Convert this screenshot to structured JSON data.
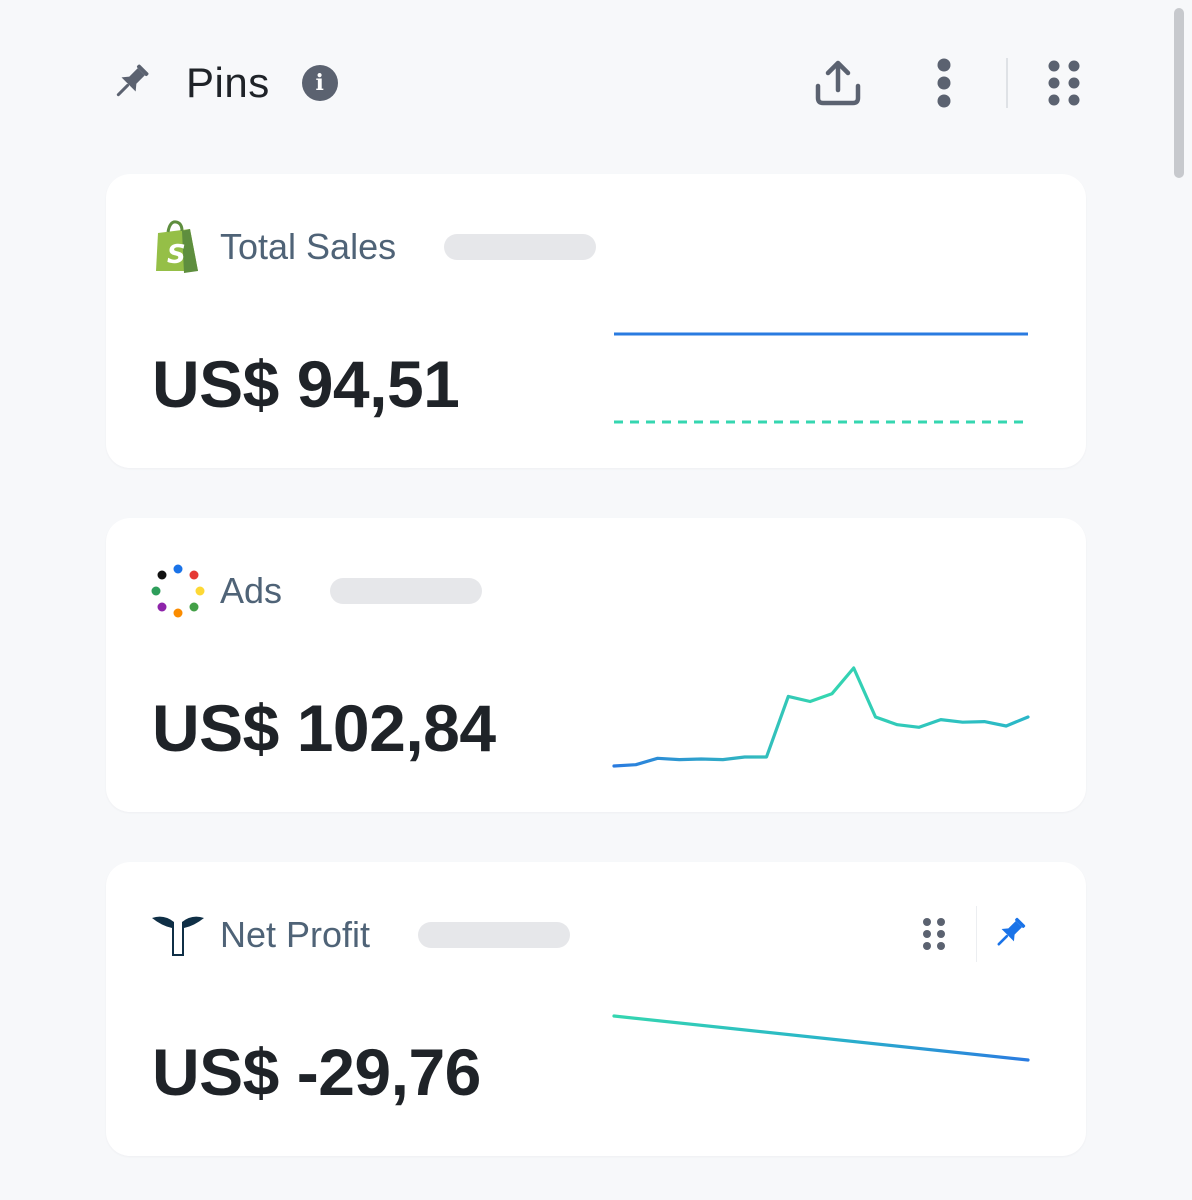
{
  "header": {
    "title": "Pins",
    "icons": {
      "pin": "pin-icon",
      "info": "info-icon",
      "share": "share-icon",
      "more": "kebab-icon",
      "grid": "grid-icon"
    },
    "info_glyph": "i"
  },
  "colors": {
    "background": "#f7f8fa",
    "card": "#ffffff",
    "title": "#1f2328",
    "card_title": "#4f6377",
    "skeleton": "#e6e7ea",
    "line_blue": "#2a7be0",
    "line_teal": "#35d6b0",
    "pin_active": "#1a73e8"
  },
  "cards": [
    {
      "title": "Total Sales",
      "value": "US$ 94,51",
      "logo": "shopify-logo",
      "sparkline": {
        "current": [
          1,
          1,
          1,
          1,
          1,
          1,
          1,
          1,
          1,
          1,
          1,
          1,
          1,
          1,
          1,
          1,
          1,
          1,
          1,
          1
        ],
        "previous": [
          0,
          0,
          0,
          0,
          0,
          0,
          0,
          0,
          0,
          0,
          0,
          0,
          0,
          0,
          0,
          0,
          0,
          0,
          0,
          0
        ],
        "previous_dashed": true
      }
    },
    {
      "title": "Ads",
      "value": "US$ 102,84",
      "logo": "ads-dots-logo",
      "sparkline": {
        "current": [
          2,
          2.5,
          5,
          4.5,
          4.7,
          4.5,
          5.5,
          5.5,
          29,
          27,
          30,
          40,
          21,
          18,
          17,
          20,
          19,
          19.2,
          17.5,
          21
        ]
      }
    },
    {
      "title": "Net Profit",
      "value": "US$ -29,76",
      "logo": "triple-whale-logo",
      "sparkline": {
        "current": [
          1,
          0
        ]
      },
      "tools": {
        "drag": "drag-handle-icon",
        "pinned": "pin-active-icon"
      }
    }
  ]
}
